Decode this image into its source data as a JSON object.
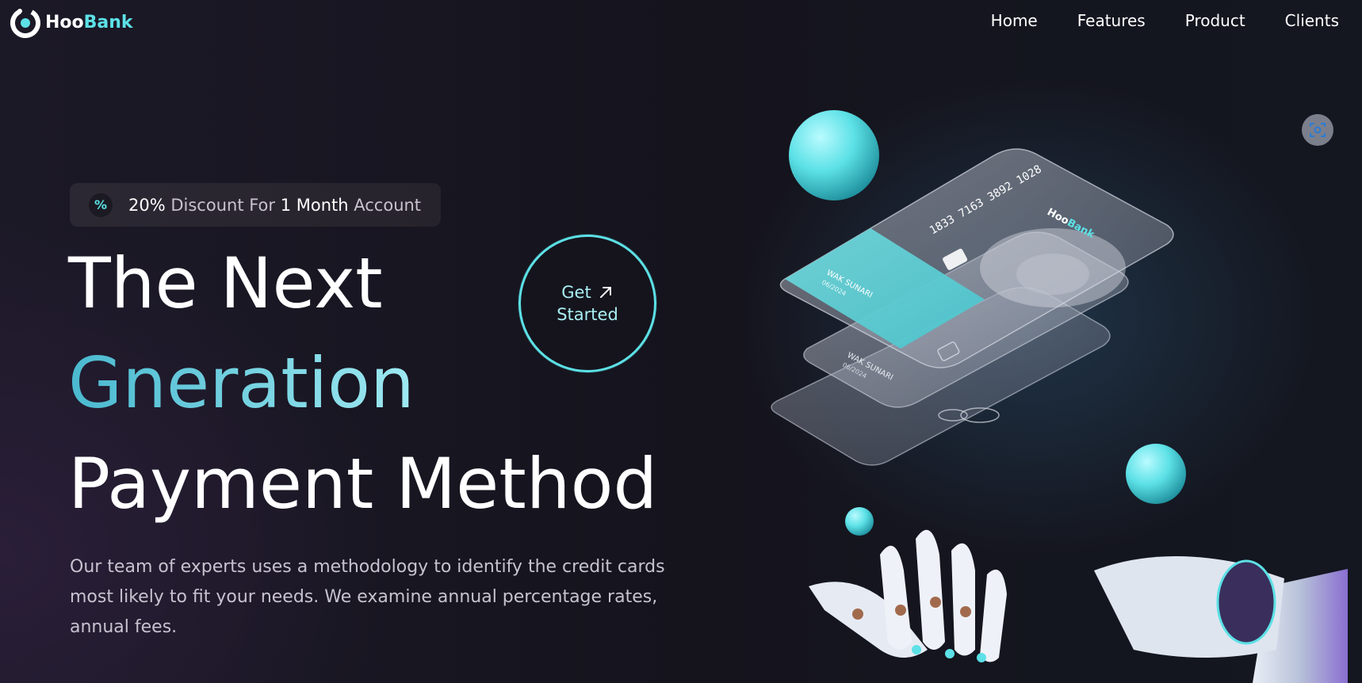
{
  "brand": {
    "name_part1": "Hoo",
    "name_part2": "Bank"
  },
  "nav": {
    "items": [
      {
        "label": "Home"
      },
      {
        "label": "Features"
      },
      {
        "label": "Product"
      },
      {
        "label": "Clients"
      }
    ]
  },
  "hero": {
    "discount": {
      "icon": "percent-icon",
      "percent": "20%",
      "text1": " Discount For ",
      "duration": "1 Month",
      "text2": " Account"
    },
    "title_line1": "The Next",
    "title_line2": "Gneration",
    "title_line3": "Payment Method",
    "description": "Our team of experts uses a methodology to identify the credit cards most likely to fit your needs. We examine annual percentage rates, annual fees.",
    "cta": {
      "line1": "Get",
      "line2": "Started",
      "icon": "arrow-up-right-icon"
    }
  },
  "illustration": {
    "card_number": "1833 7163 3892 1028",
    "card_brand_part1": "Hoo",
    "card_brand_part2": "Bank",
    "card_holder_1": "WAK SUNARI",
    "card_expiry_1": "06/2024",
    "card_holder_2": "WAK SUNARI",
    "card_expiry_2": "06/2024"
  },
  "colors": {
    "accent": "#5ce1e6",
    "background": "#17161f",
    "text": "#ffffff",
    "muted": "#c7c2cf"
  }
}
